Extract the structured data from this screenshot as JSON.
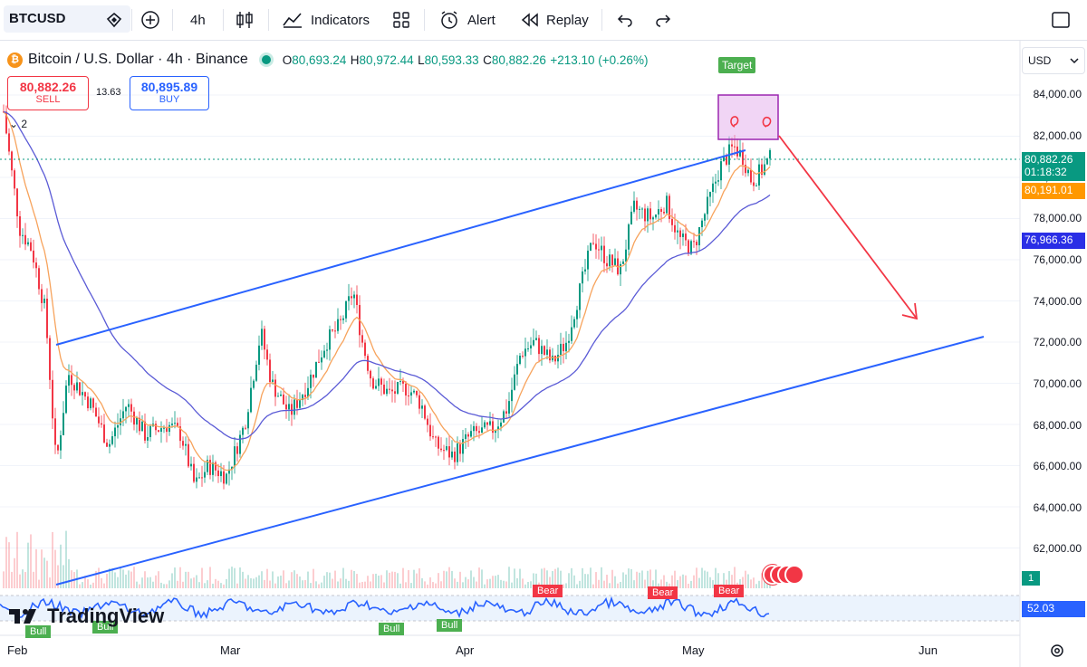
{
  "toolbar": {
    "symbol": "BTCUSD",
    "interval": "4h",
    "indicators_label": "Indicators",
    "alert_label": "Alert",
    "replay_label": "Replay"
  },
  "legend": {
    "title": "Bitcoin / U.S. Dollar · 4h · Binance",
    "open_label": "O",
    "open": "80,693.24",
    "high_label": "H",
    "high": "80,972.44",
    "low_label": "L",
    "low": "80,593.33",
    "close_label": "C",
    "close": "80,882.26",
    "change": "+213.10 (+0.26%)"
  },
  "trade": {
    "sell_price": "80,882.26",
    "sell_label": "SELL",
    "spread": "13.63",
    "buy_price": "80,895.89",
    "buy_label": "BUY"
  },
  "indicator_collapse": "2",
  "currency": "USD",
  "price_axis": [
    "84,000.00",
    "82,000.00",
    "80,000.00",
    "78,000.00",
    "76,000.00",
    "74,000.00",
    "72,000.00",
    "70,000.00",
    "68,000.00",
    "66,000.00",
    "64,000.00",
    "62,000.00"
  ],
  "price_tags": {
    "last_price": "80,882.26",
    "countdown": "01:18:32",
    "ema_fast": "80,191.01",
    "ema_slow": "76,966.36"
  },
  "rsi": {
    "pane_badge": "1",
    "value": "52.03",
    "bull_labels": [
      "Bull",
      "Bull",
      "Bull",
      "Bull"
    ],
    "bear_labels": [
      "Bear",
      "Bear",
      "Bear"
    ]
  },
  "annotations": {
    "target_label": "Target"
  },
  "time_axis": [
    "Feb",
    "Mar",
    "Apr",
    "May",
    "Jun"
  ],
  "brand": "TradingView",
  "colors": {
    "up": "#089981",
    "down": "#f23645",
    "channel": "#2962ff",
    "ema_fast": "#f7a35c",
    "ema_slow": "#5b5bd6",
    "target_box": "#9c27b0",
    "arrow": "#f23645",
    "rsi": "#2962ff"
  },
  "icons": [
    "favorite-icon",
    "add-symbol-icon",
    "candles-icon",
    "indicators-icon",
    "layouts-icon",
    "alert-icon",
    "replay-icon",
    "undo-icon",
    "redo-icon",
    "fullscreen-icon",
    "settings-icon"
  ]
}
